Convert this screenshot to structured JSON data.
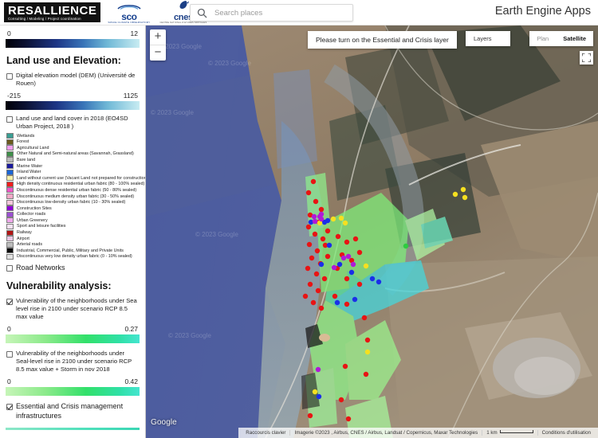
{
  "header": {
    "logo_main": "RESALLIENCE",
    "logo_sub": "Consulting  /  Modeling  /  Project coordination",
    "logo_sco_word": "sco",
    "logo_sco_sub": "SPACE CLIMATE OBSERVATORY",
    "logo_cnes_word": "cnes",
    "logo_cnes_sub": "CENTRE NATIONAL D'ETUDES SPATIALES",
    "app_title": "Earth Engine Apps",
    "search_placeholder": "Search places",
    "search_value": ""
  },
  "sidebar": {
    "top_ramp": {
      "min": "0",
      "max": "12"
    },
    "section_land_use": "Land use and Elevation:",
    "dem_layer": {
      "label": "Digital elevation model (DEM) (Université de Rouen)",
      "checked": false,
      "min": "-215",
      "max": "1125"
    },
    "lulc_layer": {
      "label": "Land use and land cover in 2018 (EO4SD Urban Project, 2018 )",
      "checked": false
    },
    "land_cover_classes": [
      {
        "color": "#3a9e93",
        "label": "Wetlands"
      },
      {
        "color": "#6b5a1e",
        "label": "Forest"
      },
      {
        "color": "#f29ef0",
        "label": "Agricultural Land"
      },
      {
        "color": "#3f8f4a",
        "label": "Other Natural and Semi-natural areas (Savannah, Grassland)"
      },
      {
        "color": "#b8b8b8",
        "label": "Bare land"
      },
      {
        "color": "#1b1b9e",
        "label": "Marine Water"
      },
      {
        "color": "#1b66d6",
        "label": "Inland Water"
      },
      {
        "color": "#f5efa8",
        "label": "Land without current use (Vacant Land not prepared for construction)"
      },
      {
        "color": "#ef1d1d",
        "label": "High density continuous residential urban fabric (80 - 100% sealed)"
      },
      {
        "color": "#ef56c8",
        "label": "Discontinuous dense residential urban fabric (50 - 80% sealed)"
      },
      {
        "color": "#f3a8c8",
        "label": "Discontinuous medium density urban fabric (30 - 50% sealed)"
      },
      {
        "color": "#f5c9dc",
        "label": "Discontinuous low-density urban fabric (10 - 30% sealed)"
      },
      {
        "color": "#8e00d6",
        "label": "Construction Sites"
      },
      {
        "color": "#9b4fd1",
        "label": "Collector roads"
      },
      {
        "color": "#f0a8ec",
        "label": "Urban Greenery"
      },
      {
        "color": "#f7e2f2",
        "label": "Sport and leisure facilities"
      },
      {
        "color": "#b01414",
        "label": "Railway"
      },
      {
        "color": "#e8c6e4",
        "label": "Airport"
      },
      {
        "color": "#bdbdbd",
        "label": "Arterial roads"
      },
      {
        "color": "#0a0a0a",
        "label": "Industrial, Commercial, Public, Military and Private Units"
      },
      {
        "color": "#e0e0e0",
        "label": "Discontinuous very low density urban fabric (0 - 10% sealed)"
      }
    ],
    "road_networks": {
      "label": "Road Networks",
      "checked": false
    },
    "section_vulnerability": "Vulnerability analysis:",
    "vuln_1": {
      "label": "Vulnerability of the neighborhoods under Sea level rise in 2100 under scenario RCP 8.5 max value",
      "checked": true,
      "min": "0",
      "max": "0.27"
    },
    "vuln_2": {
      "label": "Vulnerability of the neighborhoods under Seal-level rise in 2100 under scenario RCP 8.5 max value + Storm in nov 2018",
      "checked": false,
      "min": "0",
      "max": "0.42"
    },
    "essential": {
      "label": "Essential and Crisis management infrastructures",
      "checked": true
    }
  },
  "map": {
    "zoom_in": "+",
    "zoom_out": "−",
    "tooltip": "Please turn on the Essential and Crisis layer",
    "layers_button": "Layers",
    "basemap_plan": "Plan",
    "basemap_satellite": "Satellite",
    "provider_logo": "Google",
    "watermarks": [
      "© 2023 Google",
      "© 2023 Google",
      "© 2023 Google",
      "© 2023 Google",
      "© 2023 Google"
    ],
    "attribution": {
      "shortcuts": "Raccourcis clavier",
      "imagery": "Imagerie ©2023 , Airbus, CNES / Airbus, Landsat / Copernicus, Maxar Technologies",
      "scale": "1 km",
      "terms": "Conditions d'utilisation"
    }
  },
  "colors": {
    "accent_blue": "#17418f",
    "map_water": "#4b5a9e",
    "sidebar_border": "#c8c8c8"
  }
}
